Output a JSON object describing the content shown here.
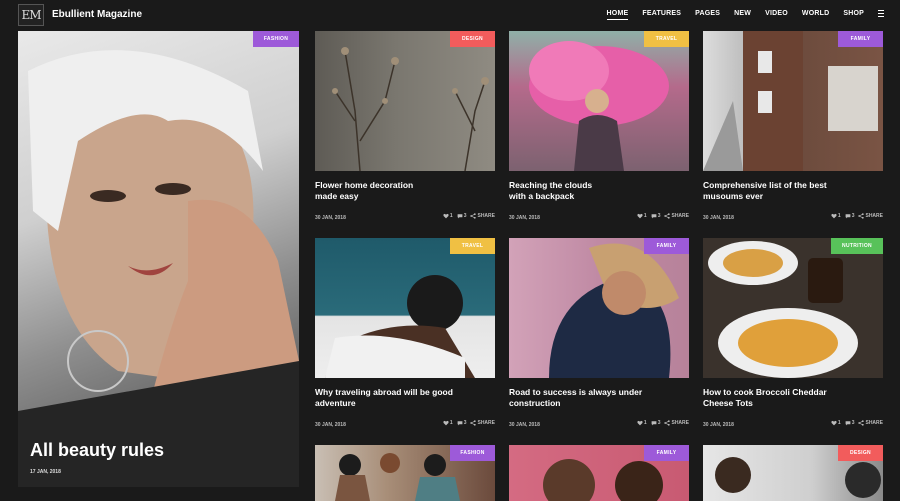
{
  "site": {
    "logo": "EM",
    "title": "Ebullient Magazine"
  },
  "nav": {
    "items": [
      {
        "label": "HOME",
        "active": true
      },
      {
        "label": "FEATURES",
        "active": false
      },
      {
        "label": "PAGES",
        "active": false
      },
      {
        "label": "NEW",
        "active": false
      },
      {
        "label": "VIDEO",
        "active": false
      },
      {
        "label": "WORLD",
        "active": false
      },
      {
        "label": "SHOP",
        "active": false
      }
    ]
  },
  "hero": {
    "tag": "FASHION",
    "title": "All beauty rules",
    "date": "17 JAN, 2018"
  },
  "cards": [
    {
      "tag": "DESIGN",
      "title_line1": "Flower home decoration",
      "title_line2": "made easy",
      "date": "30 JAN, 2018",
      "likes": "1",
      "comments": "3",
      "share": "SHARE"
    },
    {
      "tag": "TRAVEL",
      "title_line1": "Reaching the clouds",
      "title_line2": "with a backpack",
      "date": "30 JAN, 2018",
      "likes": "1",
      "comments": "3",
      "share": "SHARE"
    },
    {
      "tag": "FAMILY",
      "title_line1": "Comprehensive list of the best",
      "title_line2": "musoums ever",
      "date": "30 JAN, 2018",
      "likes": "1",
      "comments": "3",
      "share": "SHARE"
    },
    {
      "tag": "TRAVEL",
      "title_line1": "Why traveling abroad will be good",
      "title_line2": "adventure",
      "date": "30 JAN, 2018",
      "likes": "1",
      "comments": "3",
      "share": "SHARE"
    },
    {
      "tag": "FAMILY",
      "title_line1": "Road to success is always under",
      "title_line2": "construction",
      "date": "30 JAN, 2018",
      "likes": "1",
      "comments": "3",
      "share": "SHARE"
    },
    {
      "tag": "NUTRITION",
      "title_line1": "How to cook Broccoli Cheddar",
      "title_line2": "Cheese Tots",
      "date": "30 JAN, 2018",
      "likes": "1",
      "comments": "3",
      "share": "SHARE"
    },
    {
      "tag": "FASHION"
    },
    {
      "tag": "FAMILY"
    },
    {
      "tag": "DESIGN"
    }
  ],
  "colors": {
    "background": "#1a1a1a",
    "fashion": "#9d5ad9",
    "design": "#f25c5c",
    "travel": "#f0c043",
    "family": "#9d5ad9",
    "nutrition": "#58c25a"
  }
}
